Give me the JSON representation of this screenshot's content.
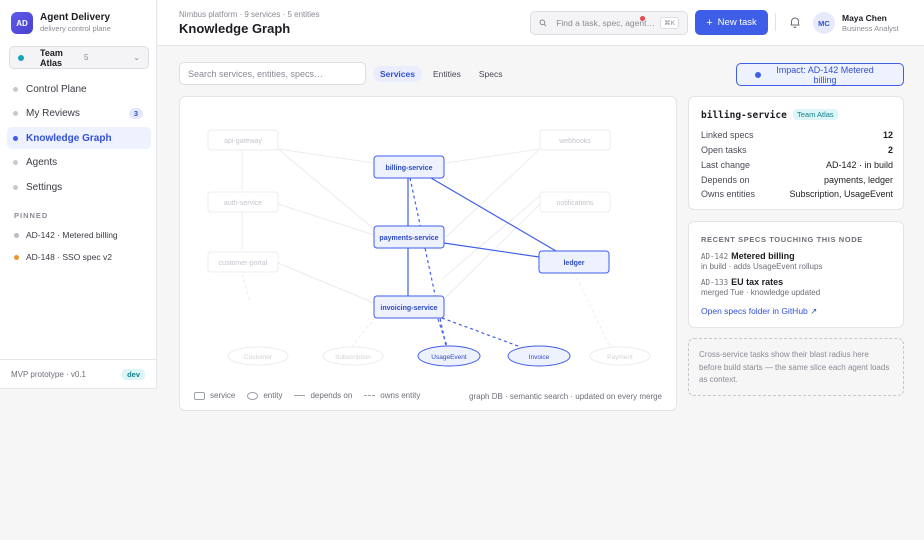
{
  "brand": {
    "logo": "AD",
    "name": "Agent Delivery",
    "subtitle": "delivery control plane"
  },
  "team_selector": {
    "name": "Team Atlas",
    "count": "5",
    "chevron": "⌄",
    "dot_color": "#16a3b8"
  },
  "nav": [
    {
      "label": "Control Plane",
      "active": false
    },
    {
      "label": "My Reviews",
      "active": false,
      "badge": "3"
    },
    {
      "label": "Knowledge Graph",
      "active": true
    },
    {
      "label": "Agents",
      "active": false
    },
    {
      "label": "Settings",
      "active": false
    }
  ],
  "pinned": {
    "heading": "PINNED",
    "items": [
      {
        "label": "AD-142 · Metered billing",
        "color": "#b9bac2"
      },
      {
        "label": "AD-148 · SSO spec v2",
        "color": "#e8962e"
      }
    ]
  },
  "sidebar_footer": {
    "version": "MVP prototype · v0.1",
    "env_badge": "dev"
  },
  "header": {
    "breadcrumb": "Nimbus platform · 9 services · 5 entities",
    "title": "Knowledge Graph",
    "search_placeholder": "Find a task, spec, agent…",
    "search_shortcut": "⌘K",
    "new_task_label": "New task",
    "new_task_icon": "+",
    "user": {
      "initials": "MC",
      "name": "Maya Chen",
      "role": "Business Analyst"
    }
  },
  "toolbar": {
    "search_placeholder": "Search services, entities, specs…",
    "tabs": [
      {
        "label": "Services",
        "active": true
      },
      {
        "label": "Entities",
        "active": false
      },
      {
        "label": "Specs",
        "active": false
      }
    ],
    "impact_label": "Impact: AD-142 Metered billing"
  },
  "graph": {
    "nodes": {
      "api_gateway": "api-gateway",
      "billing_service": "billing-service",
      "webhooks": "webhooks",
      "auth_service": "auth-service",
      "notifications": "notifications",
      "payments_service": "payments-service",
      "customer_portal": "customer-portal",
      "ledger": "ledger",
      "invoicing_service": "invoicing-service",
      "customer": "Customer",
      "subscription": "Subscription",
      "usage_event": "UsageEvent",
      "invoice": "Invoice",
      "payment": "Payment"
    },
    "legend": {
      "service": "service",
      "entity": "entity",
      "depends_on": "depends on",
      "owns_entity": "owns entity"
    },
    "footer": "graph DB · semantic search · updated on every merge",
    "colors": {
      "highlight": "#3e5ee8",
      "highlight_fill": "#eef1fe",
      "dim": "#e4e4e8"
    }
  },
  "detail": {
    "title": "billing-service",
    "team_badge": "Team Atlas",
    "rows": [
      {
        "key": "Linked specs",
        "value": "12"
      },
      {
        "key": "Open tasks",
        "value": "2"
      },
      {
        "key": "Last change",
        "value": "AD-142 · in build"
      },
      {
        "key": "Depends on",
        "value": "payments, ledger"
      },
      {
        "key": "Owns entities",
        "value": "Subscription, UsageEvent"
      }
    ]
  },
  "recent_specs": {
    "heading": "RECENT SPECS TOUCHING THIS NODE",
    "items": [
      {
        "id": "AD-142",
        "title": "Metered billing",
        "subtitle": "in build · adds UsageEvent rollups"
      },
      {
        "id": "AD-133",
        "title": "EU tax rates",
        "subtitle": "merged Tue · knowledge updated"
      }
    ],
    "link": "Open specs folder in GitHub ↗"
  },
  "note": "Cross-service tasks show their blast radius here before build starts — the same slice each agent loads as context."
}
